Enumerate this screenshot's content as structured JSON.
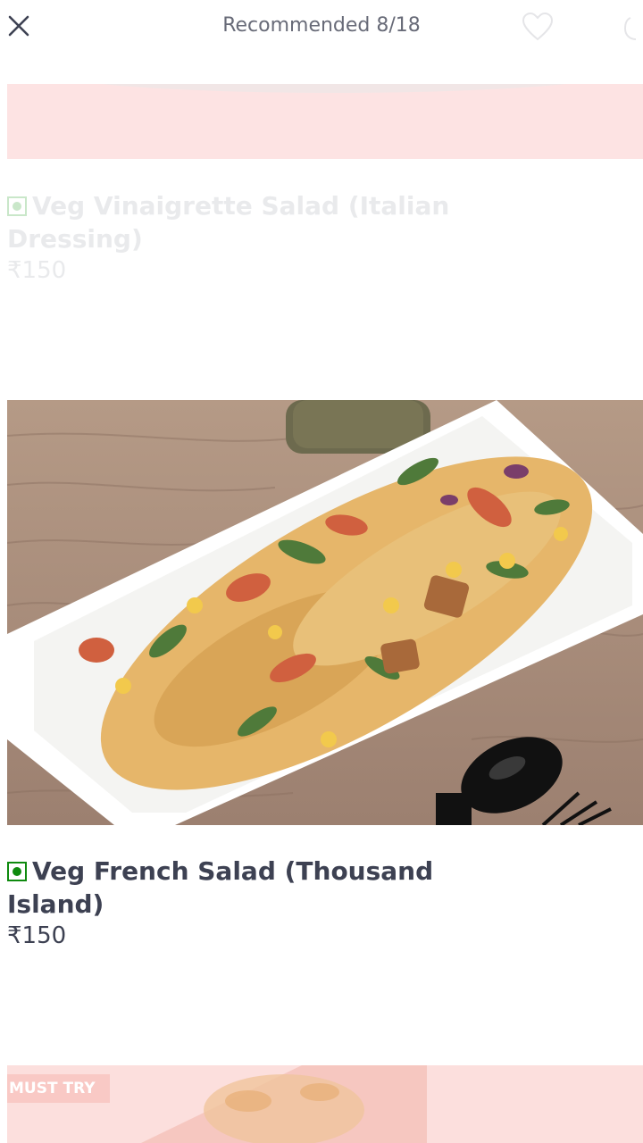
{
  "header": {
    "title": "Recommended 8/18"
  },
  "items": [
    {
      "name": "Veg Vinaigrette Salad (Italian Dressing)",
      "price": "₹150",
      "veg": true
    },
    {
      "name": "Veg French Salad (Thousand Island)",
      "price": "₹150",
      "veg": true
    }
  ],
  "next_item": {
    "badge": "MUST TRY"
  },
  "colors": {
    "veg_green": "#0f8a0f",
    "text_dark": "#3d4152",
    "text_muted": "#686b78",
    "faded_pink": "#fde3e3"
  },
  "icons": [
    "close-icon",
    "heart-icon",
    "share-icon"
  ]
}
